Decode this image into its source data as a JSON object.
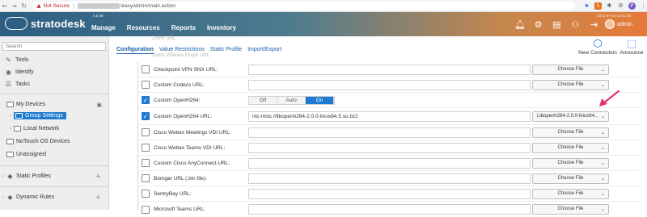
{
  "browser": {
    "not_secure": "Not Secure",
    "separator": "|",
    "url_path": "/easyadmin/main.action",
    "ext_badge": "5",
    "profile_initial": "P"
  },
  "app": {
    "brand": "stratodesk",
    "version": "4.5.68",
    "timestamp": "2021-07-19 13:51:46",
    "nav": [
      "Manage",
      "Resources",
      "Reports",
      "Inventory"
    ],
    "header_icons": [
      "bell-icon",
      "gear-icon",
      "document-icon",
      "users-icon",
      "logout-icon"
    ],
    "user": "admin",
    "colors": {
      "header_start": "#2d5d82",
      "header_end": "#e67a3a",
      "accent": "#1e7ad0",
      "pink_arrow": "#e8336b"
    }
  },
  "sidebar": {
    "search_placeholder": "Search",
    "items": [
      {
        "label": "Tools",
        "icon": "wrench-icon"
      },
      {
        "label": "Identify",
        "icon": "user-circle-icon"
      },
      {
        "label": "Tasks",
        "icon": "list-icon"
      }
    ],
    "tree": {
      "my_devices": "My Devices",
      "group_settings": "Group Settings",
      "local_network": "Local Network",
      "notouch": "NoTouch OS Devices",
      "unassigned": "Unassigned",
      "static_profiles": "Static Profiles",
      "dynamic_rules": "Dynamic Rules"
    }
  },
  "content": {
    "tabs": [
      "Configuration",
      "Value Restrictions",
      "Static Profile",
      "Import/Export"
    ],
    "ghost_top": "Zoom URL:",
    "ghost_second": "Zoom VMware Plugin URL:",
    "actions": {
      "new_connection": "New Connection",
      "announce": "Announce"
    },
    "rows": [
      {
        "label": "Checkpoint VPN SNX URL:",
        "checked": false,
        "field": "",
        "file": "Choose File"
      },
      {
        "label": "Custom Codecs URL:",
        "checked": false,
        "field": "",
        "file": "Choose File"
      },
      {
        "label": "Custom OpenH264:",
        "checked": true,
        "toggle": [
          "Off",
          "Auto",
          "On"
        ]
      },
      {
        "label": "Custom OpenH264 URL:",
        "checked": true,
        "field": "ntc-misc://libopenh264-2.0.0-linux64.5.so.bz2",
        "file": "Libopenh264-2.0.0-linux64..."
      },
      {
        "label": "Cisco Webex Meetings VDI URL:",
        "checked": false,
        "field": "",
        "file": "Choose File"
      },
      {
        "label": "Cisco Webex Teams VDI URL:",
        "checked": false,
        "field": "",
        "file": "Choose File"
      },
      {
        "label": "Custom Cisco AnyConnect-URL:",
        "checked": false,
        "field": "",
        "file": "Choose File"
      },
      {
        "label": "Bomgar URL (.bin file):",
        "checked": false,
        "field": "",
        "file": "Choose File"
      },
      {
        "label": "SentryBay URL:",
        "checked": false,
        "field": "",
        "file": "Choose File"
      },
      {
        "label": "Microsoft Teams URL:",
        "checked": false,
        "field": "",
        "file": "Choose File"
      }
    ]
  }
}
